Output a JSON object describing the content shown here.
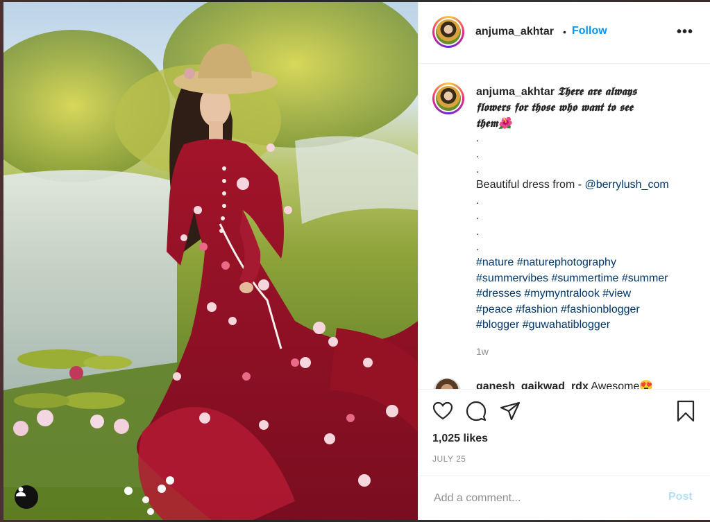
{
  "post": {
    "author": "anjuma_akhtar",
    "follow_label": "Follow",
    "separator": "•",
    "more_label": "•••"
  },
  "caption": {
    "username": "anjuma_akhtar",
    "title_line1": "𝕿𝖍𝖊𝖗𝖊 𝖆𝖗𝖊 𝖆𝖑𝖜𝖆𝖞𝖘",
    "title_line2": "𝖋𝖑𝖔𝖜𝖊𝖗𝖘 𝖋𝖔𝖗 𝖙𝖍𝖔𝖘𝖊 𝖜𝖍𝖔 𝖜𝖆𝖓𝖙 𝖙𝖔 𝖘𝖊𝖊",
    "title_line3": "𝖙𝖍𝖊𝖒🌺",
    "dot": ".",
    "dress_text": "Beautiful dress from - ",
    "mention": "@berrylush_com",
    "hashtags_line1": "#nature #naturephotography",
    "hashtags_line2": "#summervibes #summertime #summer",
    "hashtags_line3": "#dresses #mymyntralook #view",
    "hashtags_line4": "#peace #fashion #fashionblogger",
    "hashtags_line5": "#blogger #guwahatiblogger",
    "time": "1w"
  },
  "comment": {
    "username": "ganesh_gaikwad_rdx",
    "text": "Awesome😍"
  },
  "stats": {
    "likes": "1,025 likes",
    "date": "JULY 25"
  },
  "add_comment": {
    "placeholder": "Add a comment...",
    "post_label": "Post"
  },
  "icons": {
    "like": "heart-icon",
    "comment": "comment-icon",
    "share": "paper-plane-icon",
    "save": "bookmark-icon",
    "tag": "user-tag-icon"
  },
  "colors": {
    "link_blue": "#0095f6",
    "hashtag": "#00376b",
    "muted": "#8e8e8e",
    "post_disabled": "#b2dffc"
  }
}
